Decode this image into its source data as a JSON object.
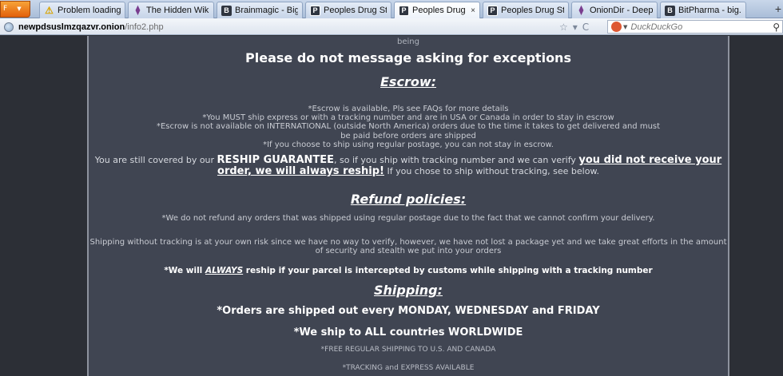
{
  "browser": {
    "menu_button": {
      "label": "F",
      "color": "#e8701a"
    },
    "tabs": [
      {
        "label": "Problem loading...",
        "icon": "warning-icon",
        "active": false
      },
      {
        "label": "The Hidden Wiki",
        "icon": "onion-icon",
        "active": false
      },
      {
        "label": "Brainmagic - Big...",
        "icon": "b-icon",
        "active": false
      },
      {
        "label": "Peoples Drug St...",
        "icon": "p-icon",
        "active": false
      },
      {
        "label": "Peoples Drug ...",
        "icon": "p-icon",
        "active": true
      },
      {
        "label": "Peoples Drug St...",
        "icon": "p-icon",
        "active": false
      },
      {
        "label": "OnionDir - Deep ...",
        "icon": "onion-icon",
        "active": false
      },
      {
        "label": "BitPharma - big...",
        "icon": "b-icon",
        "active": false
      }
    ],
    "tab_close": "×",
    "new_tab": "+",
    "url": {
      "host": "newpdsuslmzqazvr.onion",
      "path": "/info2.php"
    },
    "url_controls": {
      "star": "☆",
      "dropdown": "▾",
      "reload": "C"
    },
    "search": {
      "engine_icon": "duckduckgo-icon",
      "placeholder": "DuckDuckGo",
      "search_icon": "magnifier-icon"
    }
  },
  "page": {
    "top_fragment": "being",
    "notice": "Please do not message asking for exceptions",
    "escrow": {
      "heading": "Escrow:",
      "lines": [
        "*Escrow is available, Pls see FAQs for more details",
        "*You MUST ship express or with a tracking number and are in USA or Canada in order to stay in escrow",
        "*Escrow is not available on INTERNATIONAL (outside North America) orders due to the time it takes to get delivered and must",
        "be paid before orders are shipped",
        "*If you choose to ship using regular postage, you can not stay in escrow."
      ],
      "reship": {
        "part1": "You are still covered by our ",
        "guarantee": "RESHIP GUARANTEE",
        "part2": ", so if you ship with tracking number and we can verify ",
        "promise": "you did not receive your order, we will always reship!",
        "part3": " If you chose to ship without tracking, see below."
      }
    },
    "refund": {
      "heading": "Refund policies:",
      "line1": "*We do not refund any orders that was shipped using regular postage due to the fact that we cannot confirm your delivery.",
      "line2": "Shipping without tracking is at your own risk since we have no way to verify, however, we have not lost a package yet and we take great efforts in the amount of security and stealth we put into your orders",
      "always": {
        "before": "*We will ",
        "word": "ALWAYS",
        "after": " reship if your parcel is intercepted by customs while shipping with a tracking number"
      }
    },
    "shipping": {
      "heading": "Shipping:",
      "days": "*Orders are shipped out every MONDAY, WEDNESDAY and FRIDAY",
      "worldwide": "*We ship to ALL countries WORLDWIDE",
      "free": "*FREE REGULAR SHIPPING TO U.S. AND CANADA",
      "tracking": "*TRACKING and EXPRESS AVAILABLE"
    }
  },
  "colors": {
    "page_background": "#2c2f36",
    "content_background": "#404552",
    "heading_text": "#ffffff",
    "body_text": "#d8dbe0"
  }
}
